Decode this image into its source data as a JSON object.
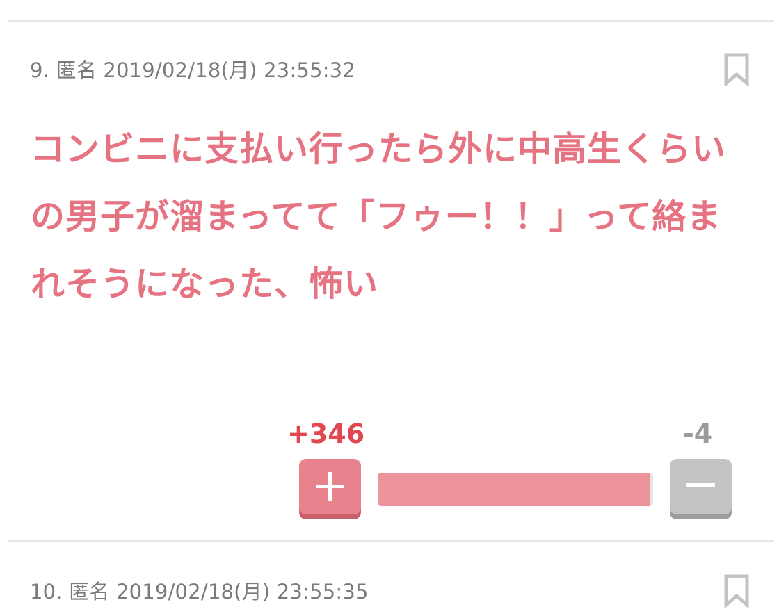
{
  "comments": [
    {
      "number": "9.",
      "author": "匿名",
      "timestamp": "2019/02/18(月) 23:55:32",
      "text": "コンビニに支払い行ったら外に中高生くらいの男子が溜まってて「フゥー！！」って絡まれそうになった、怖い",
      "plus_label": "+346",
      "minus_label": "-4",
      "plus_ratio": 0.988
    },
    {
      "number": "10.",
      "author": "匿名",
      "timestamp": "2019/02/18(月) 23:55:35"
    }
  ],
  "icons": {
    "bookmark": "bookmark-icon",
    "plus": "plus-icon",
    "minus": "minus-icon"
  },
  "colors": {
    "comment_text": "#e57381",
    "plus_count": "#e0474f",
    "minus_count": "#9b9b9b",
    "plus_button": "#e8838d",
    "minus_button": "#c3c3c3",
    "bar_fill": "#ec939b",
    "bar_track": "#e6e6e6"
  }
}
